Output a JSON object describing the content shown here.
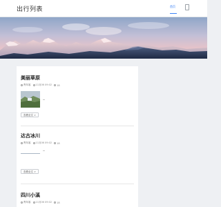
{
  "header": {
    "site_title": "出行列表",
    "nav_home": "首页",
    "mobile_icon": "phone-icon"
  },
  "banner": {
    "icon": "mountain-banner-image"
  },
  "posts": [
    {
      "title": "美丽草原",
      "author": "青年客",
      "date": "11月06 09:02",
      "views": "18",
      "read_more": "查看全文 >"
    },
    {
      "title": "达古冰川",
      "author": "青年客",
      "date": "11月06 09:02",
      "views": "18",
      "read_more": "查看全文 >"
    },
    {
      "title": "四川小溪",
      "author": "青年客",
      "date": "11月06 09:02",
      "views": "18"
    }
  ],
  "colors": {
    "accent": "#3b82f6",
    "page_bg": "#eef0f3",
    "card_bg": "#ffffff"
  }
}
